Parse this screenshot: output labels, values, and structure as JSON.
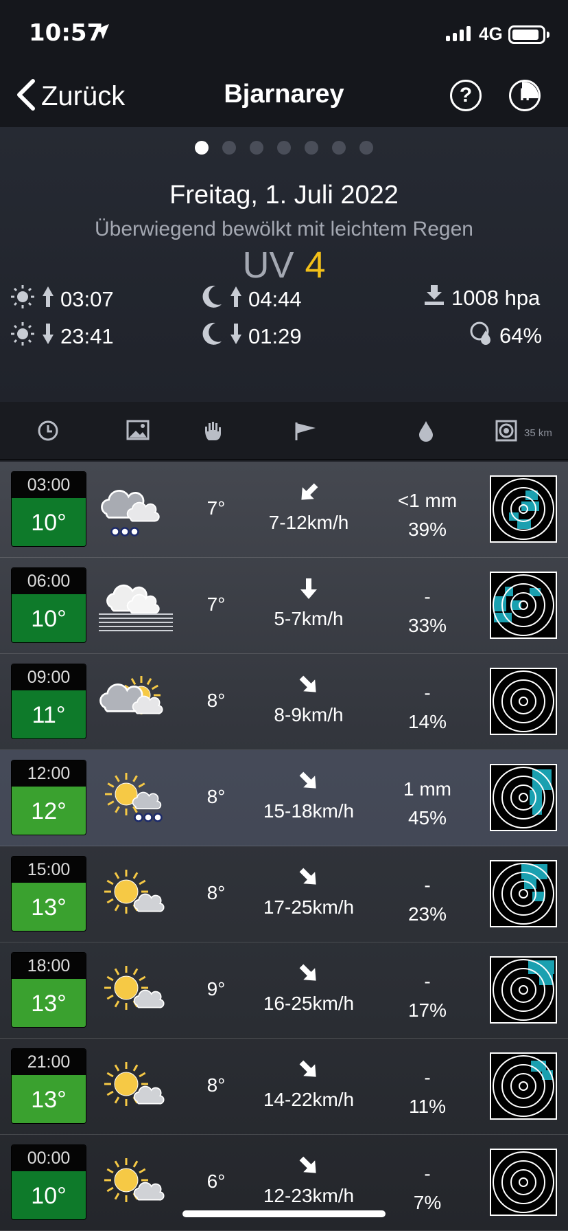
{
  "status_bar": {
    "time": "10:57",
    "network": "4G"
  },
  "nav": {
    "back_label": "Zurück",
    "title": "Bjarnarey",
    "help_icon": "?",
    "h_icon": "h"
  },
  "pager": {
    "count": 7,
    "active_index": 0
  },
  "summary": {
    "date": "Freitag, 1. Juli 2022",
    "condition": "Überwiegend bewölkt mit leichtem Regen",
    "uv_label": "UV",
    "uv_value": "4"
  },
  "astro": {
    "sunrise": "03:07",
    "sunset": "23:41",
    "moonrise": "04:44",
    "moonset": "01:29",
    "pressure": "1008 hpa",
    "humidity": "64%"
  },
  "columns": {
    "icons": [
      "clock-icon",
      "weather-image-icon",
      "hand-icon",
      "wind-flag-icon",
      "raindrop-icon",
      "radar-icon"
    ],
    "radar_range": "35 km"
  },
  "colors": {
    "temp_dark_green": "#0e7a2a",
    "temp_light_green": "#3aa12f",
    "uv_yellow": "#f3c019",
    "radar_cyan": "#1aa0b0"
  },
  "forecast": [
    {
      "time": "03:00",
      "temp": "10°",
      "feels": "7°",
      "wind": "7-12km/h",
      "wind_dir": "from-northeast",
      "precip": "<1 mm",
      "prob": "39%",
      "icon": "cloud-rain-icon"
    },
    {
      "time": "06:00",
      "temp": "10°",
      "feels": "7°",
      "wind": "5-7km/h",
      "wind_dir": "from-north",
      "precip": "-",
      "prob": "33%",
      "icon": "fog-cloud-icon"
    },
    {
      "time": "09:00",
      "temp": "11°",
      "feels": "8°",
      "wind": "8-9km/h",
      "wind_dir": "from-northwest",
      "precip": "-",
      "prob": "14%",
      "icon": "partly-cloudy-icon"
    },
    {
      "time": "12:00",
      "temp": "12°",
      "feels": "8°",
      "wind": "15-18km/h",
      "wind_dir": "from-northwest",
      "precip": "1 mm",
      "prob": "45%",
      "icon": "sun-cloud-rain-icon"
    },
    {
      "time": "15:00",
      "temp": "13°",
      "feels": "8°",
      "wind": "17-25km/h",
      "wind_dir": "from-northwest",
      "precip": "-",
      "prob": "23%",
      "icon": "sun-small-cloud-icon"
    },
    {
      "time": "18:00",
      "temp": "13°",
      "feels": "9°",
      "wind": "16-25km/h",
      "wind_dir": "from-northwest",
      "precip": "-",
      "prob": "17%",
      "icon": "sun-small-cloud-icon"
    },
    {
      "time": "21:00",
      "temp": "13°",
      "feels": "8°",
      "wind": "14-22km/h",
      "wind_dir": "from-northwest",
      "precip": "-",
      "prob": "11%",
      "icon": "sun-small-cloud-icon"
    },
    {
      "time": "00:00",
      "temp": "10°",
      "feels": "6°",
      "wind": "12-23km/h",
      "wind_dir": "from-northwest",
      "precip": "-",
      "prob": "7%",
      "icon": "sun-small-cloud-icon"
    }
  ]
}
